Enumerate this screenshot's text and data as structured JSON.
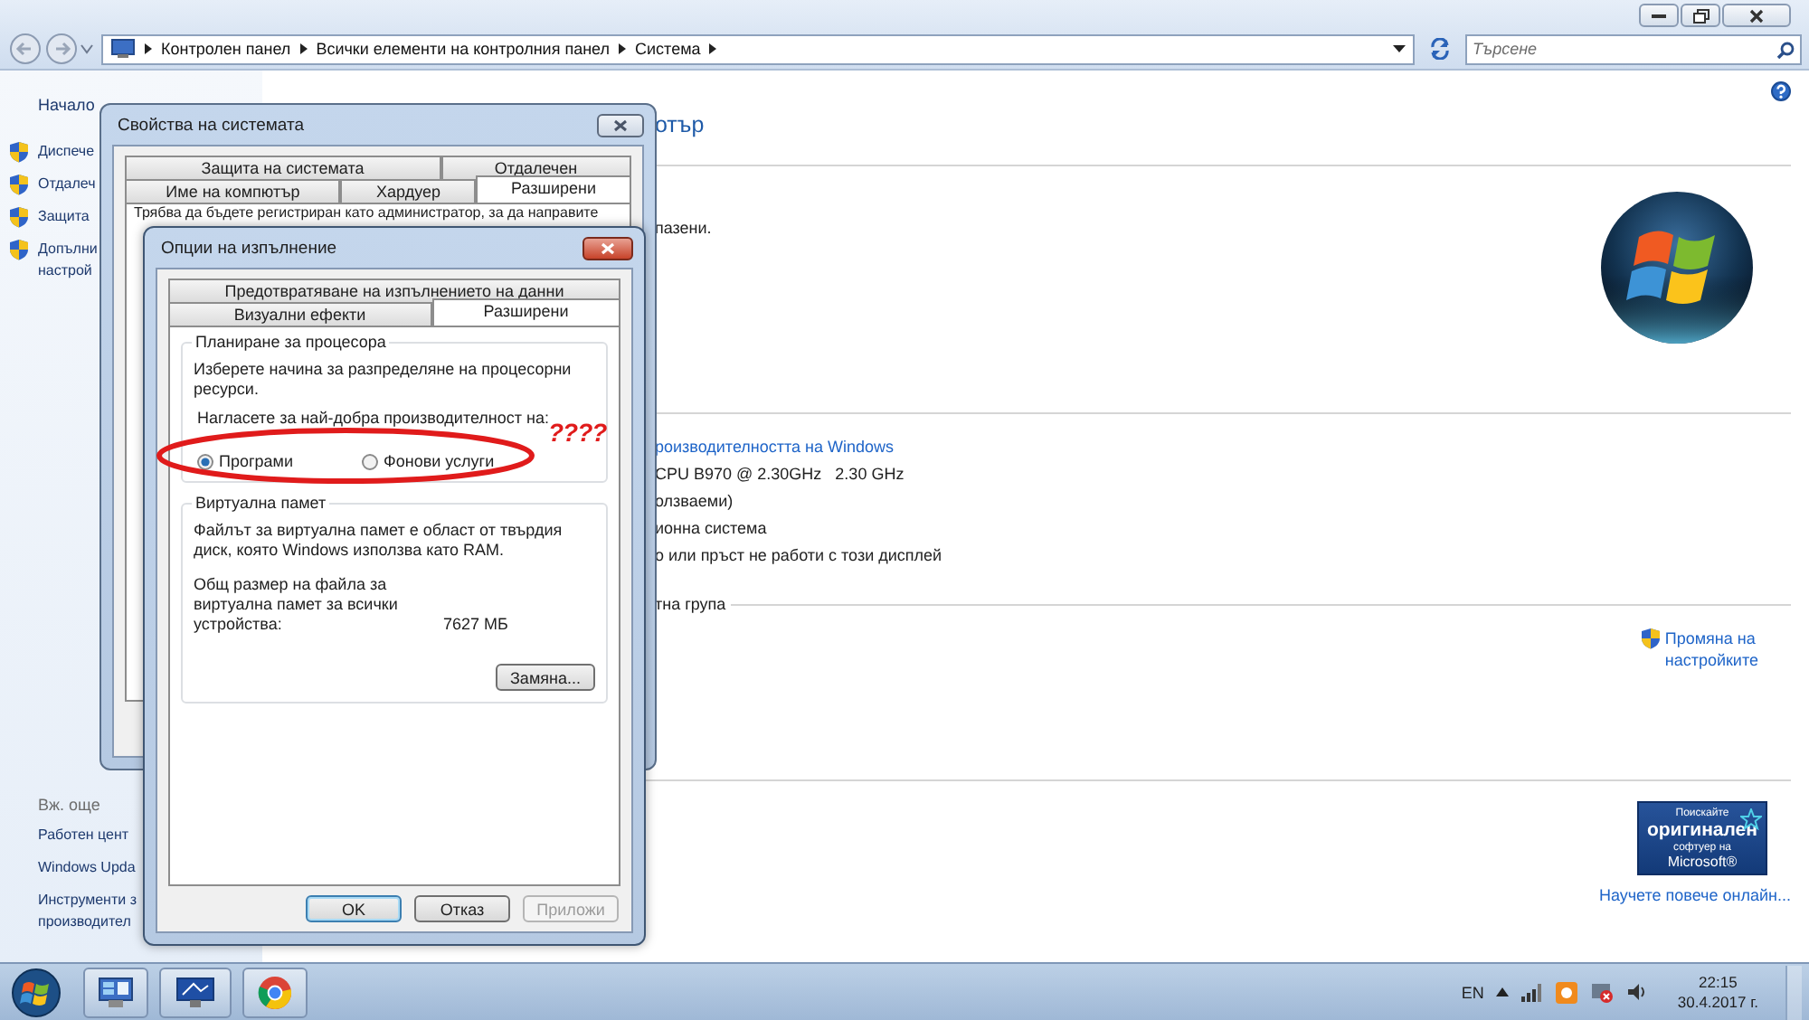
{
  "address_bar": {
    "crumbs": [
      "Контролен панел",
      "Всички елементи на контролния панел",
      "Система"
    ]
  },
  "search": {
    "placeholder": "Търсене"
  },
  "sidebar": {
    "home": "Начало",
    "tasks": [
      "Диспече",
      "Отдалеч",
      "Защита",
      "Допълни\nнастрой"
    ],
    "see_also_title": "Вж. още",
    "see_also": [
      "Работен цент",
      "Windows Upda",
      "Инструменти з\nпроизводител"
    ]
  },
  "main": {
    "heading": "отър",
    "notice": "пазени.",
    "rating_link": "роизводителността на Windows",
    "specs": [
      "CPU B970 @ 2.30GHz   2.30 GHz",
      "олзваеми)",
      "ионна система",
      "о или пръст не работи с този дисплей"
    ],
    "group_header": "тна група",
    "change_settings": "Промяна на\nнастройките",
    "genuine_badge": [
      "Поискайте",
      "оригинален",
      "софтуер на",
      "Microsoft®"
    ],
    "learn_more": "Научете повече онлайн..."
  },
  "system_properties": {
    "title": "Свойства на системата",
    "tab_rows": [
      [
        {
          "label": "Защита на системата",
          "selected": false
        },
        {
          "label": "Отдалечен",
          "selected": false
        }
      ],
      [
        {
          "label": "Име на компютър",
          "selected": false
        },
        {
          "label": "Хардуер",
          "selected": false
        },
        {
          "label": "Разширени",
          "selected": true
        }
      ]
    ],
    "admin_notice": "Трябва да бъдете регистриран като администратор, за да направите"
  },
  "performance_options": {
    "title": "Опции на изпълнение",
    "tab_rows": [
      [
        {
          "label": "Предотвратяване на изпълнението на данни",
          "selected": false
        }
      ],
      [
        {
          "label": "Визуални ефекти",
          "selected": false
        },
        {
          "label": "Разширени",
          "selected": true
        }
      ]
    ],
    "processor": {
      "title": "Планиране за процесора",
      "description": "Изберете начина за разпределяне на процесорни ресурси.",
      "prompt": "Нагласете за най-добра производителност на:",
      "options": [
        {
          "label": "Програми",
          "selected": true
        },
        {
          "label": "Фонови услуги",
          "selected": false
        }
      ]
    },
    "memory": {
      "title": "Виртуална памет",
      "description": "Файлът за виртуална памет е област от твърдия диск, която Windows използва като RAM.",
      "size_label": "Общ размер на файла за виртуална памет за всички устройства:",
      "size_value": "7627 МБ",
      "change_button": "Замяна..."
    },
    "buttons": [
      {
        "label": "OK",
        "disabled": false
      },
      {
        "label": "Отказ",
        "disabled": false
      },
      {
        "label": "Приложи",
        "disabled": true
      }
    ]
  },
  "annotation": {
    "text": "????"
  },
  "taskbar": {
    "language": "EN",
    "time": "22:15",
    "date": "30.4.2017 г."
  }
}
